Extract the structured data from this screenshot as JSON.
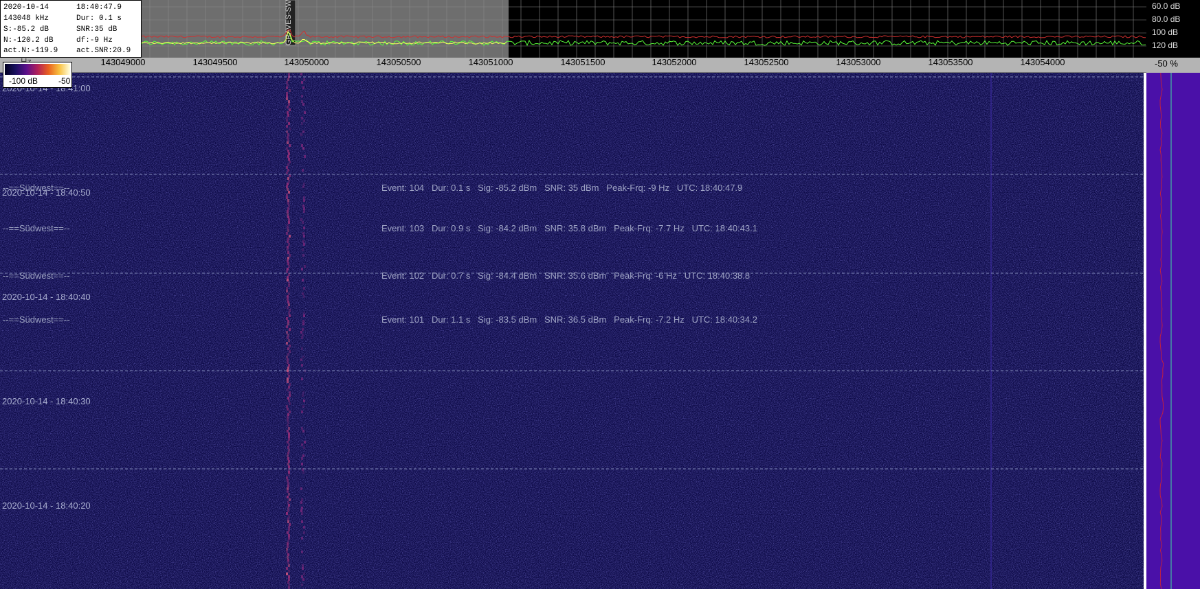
{
  "info": {
    "date": "2020-10-14",
    "time": "18:40:47.9",
    "freq": "143048 kHz",
    "dur": "Dur: 0.1 s",
    "signal": "S:-85.2 dB",
    "snr": "SNR:35 dB",
    "noise": "N:-120.2 dB",
    "df": "df:-9 Hz",
    "act_noise": "act.N:-119.9",
    "act_snr": "act.SNR:20.9"
  },
  "db_scale": [
    "60.0 dB",
    "80.0 dB",
    "100 dB",
    "120 dB"
  ],
  "freq_axis": {
    "overlay": "Hz",
    "ticks": [
      "143049000",
      "143049500",
      "143050000",
      "143050500",
      "143051000",
      "143051500",
      "143052000",
      "143052500",
      "143053000",
      "143053500",
      "143054000"
    ]
  },
  "marker_label": "GRAVES-SW",
  "percent_label": "-50 %",
  "colorbar": {
    "min": "-100 dB",
    "max": "-50"
  },
  "time_labels": [
    "2020-10-14 - 18:41:00",
    "2020-10-14 - 18:40:50",
    "2020-10-14 - 18:40:40",
    "2020-10-14 - 18:40:30",
    "2020-10-14 - 18:40:20"
  ],
  "direction_labels": [
    "--==Südwest==--",
    "--==Südwest==--",
    "--==Südwest==--",
    "--==Südwest==--"
  ],
  "events": [
    "Event: 104   Dur: 0.1 s   Sig: -85.2 dBm   SNR: 35 dBm   Peak-Frq: -9 Hz   UTC: 18:40:47.9",
    "Event: 103   Dur: 0.9 s   Sig: -84.2 dBm   SNR: 35.8 dBm   Peak-Frq: -7.7 Hz   UTC: 18:40:43.1",
    "Event: 102   Dur: 0.7 s   Sig: -84.4 dBm   SNR: 35.6 dBm   Peak-Frq: -6 Hz   UTC: 18:40:38.8",
    "Event: 101   Dur: 1.1 s   Sig: -83.5 dBm   SNR: 36.5 dBm   Peak-Frq: -7.2 Hz   UTC: 18:40:34.2"
  ],
  "colors": {
    "waterfall_bg": "#0f0c4a",
    "trace_green": "#5aff3a",
    "trace_red": "#d03030",
    "trace_yellow": "#ffff60",
    "sidebar": "#4a10a8"
  }
}
